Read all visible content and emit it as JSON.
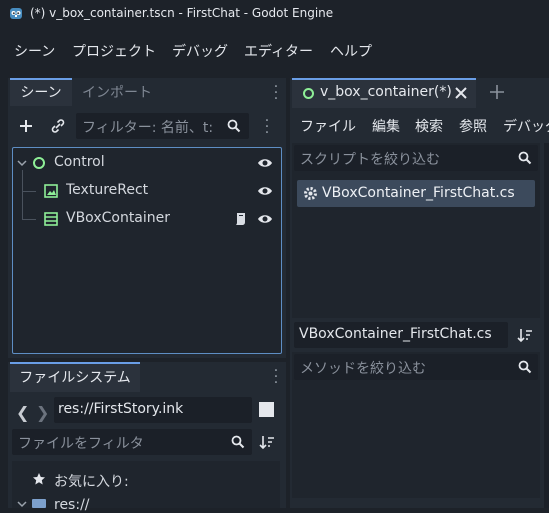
{
  "window": {
    "title": "(*) v_box_container.tscn - FirstChat - Godot Engine"
  },
  "menubar": {
    "items": [
      "シーン",
      "プロジェクト",
      "デバッグ",
      "エディター",
      "ヘルプ"
    ]
  },
  "scene_dock": {
    "tabs": [
      "シーン",
      "インポート"
    ],
    "filter_placeholder": "フィルター: 名前、t:",
    "tree": [
      {
        "name": "Control",
        "icon": "control-node-icon"
      },
      {
        "name": "TextureRect",
        "icon": "texture-rect-icon"
      },
      {
        "name": "VBoxContainer",
        "icon": "vbox-container-icon"
      }
    ]
  },
  "filesystem_dock": {
    "tab": "ファイルシステム",
    "path": "res://FirstStory.ink",
    "filter_placeholder": "ファイルをフィルタ",
    "favorites": "お気に入り:",
    "res_root": "res://"
  },
  "script_editor": {
    "tab": "v_box_container(*)",
    "menu": [
      "ファイル",
      "編集",
      "検索",
      "参照",
      "デバッグ"
    ],
    "script_filter_placeholder": "スクリプトを絞り込む",
    "scripts": [
      "VBoxContainer_FirstChat.cs"
    ],
    "current_script": "VBoxContainer_FirstChat.cs",
    "method_filter_placeholder": "メソッドを絞り込む"
  },
  "colors": {
    "accent": "#6a9ee6",
    "node_green": "#8eef97",
    "selected": "#3c4a5c"
  }
}
